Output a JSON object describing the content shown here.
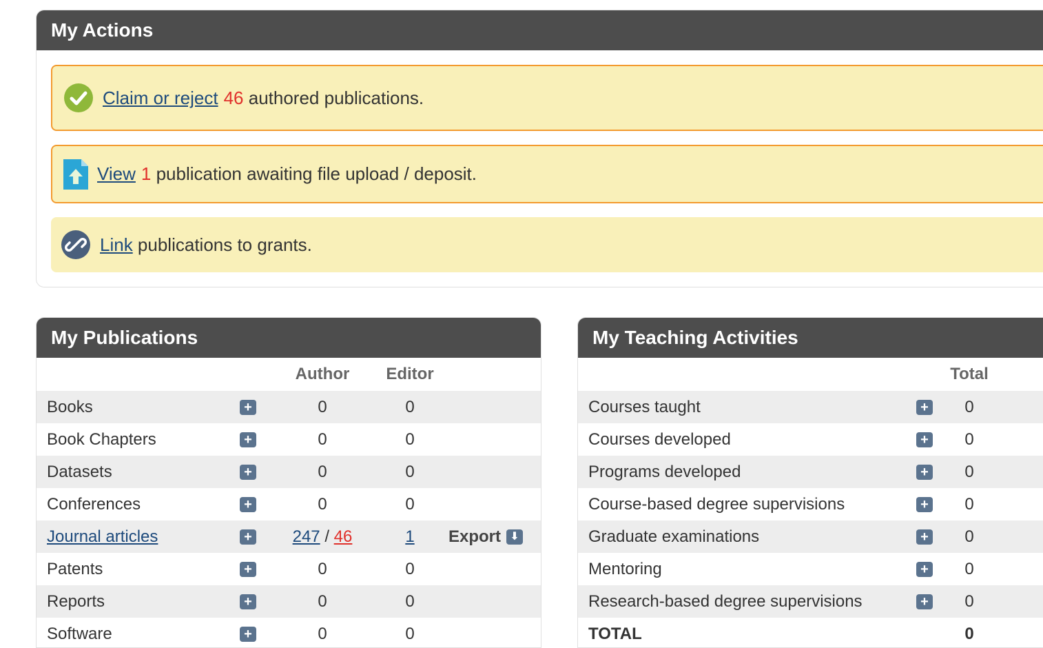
{
  "actions": {
    "title": "My Actions",
    "alerts": [
      {
        "link": "Claim or reject",
        "count": "46",
        "text": " authored publications.",
        "icon": "check-circle-icon"
      },
      {
        "link": "View",
        "count": "1",
        "text": " publication awaiting file upload / deposit.",
        "icon": "file-upload-icon"
      },
      {
        "link": "Link",
        "count": "",
        "text": " publications to grants.",
        "icon": "chain-link-icon"
      }
    ]
  },
  "publications": {
    "title": "My Publications",
    "columns": [
      "",
      "",
      "Author",
      "Editor",
      ""
    ],
    "rows": [
      {
        "name": "Books",
        "author": "0",
        "editor": "0"
      },
      {
        "name": "Book Chapters",
        "author": "0",
        "editor": "0"
      },
      {
        "name": "Datasets",
        "author": "0",
        "editor": "0"
      },
      {
        "name": "Conferences",
        "author": "0",
        "editor": "0"
      },
      {
        "name": "Journal articles",
        "author": "247",
        "author_sep": " / ",
        "author_pending": "46",
        "editor": "1",
        "export": "Export"
      },
      {
        "name": "Patents",
        "author": "0",
        "editor": "0"
      },
      {
        "name": "Reports",
        "author": "0",
        "editor": "0"
      },
      {
        "name": "Software",
        "author": "0",
        "editor": "0"
      }
    ]
  },
  "teaching": {
    "title": "My Teaching Activities",
    "total_header": "Total",
    "rows": [
      {
        "name": "Courses taught",
        "total": "0"
      },
      {
        "name": "Courses developed",
        "total": "0"
      },
      {
        "name": "Programs developed",
        "total": "0"
      },
      {
        "name": "Course-based degree supervisions",
        "total": "0"
      },
      {
        "name": "Graduate examinations",
        "total": "0"
      },
      {
        "name": "Mentoring",
        "total": "0"
      },
      {
        "name": "Research-based degree supervisions",
        "total": "0"
      }
    ],
    "total_row": {
      "name": "TOTAL",
      "total": "0"
    }
  },
  "colors": {
    "header_bg": "#4d4d4d",
    "alert_bg": "#f9f0b9",
    "alert_border": "#f39a2e",
    "link": "#1d4a7c",
    "count_red": "#e0302b",
    "button": "#5b738e"
  }
}
